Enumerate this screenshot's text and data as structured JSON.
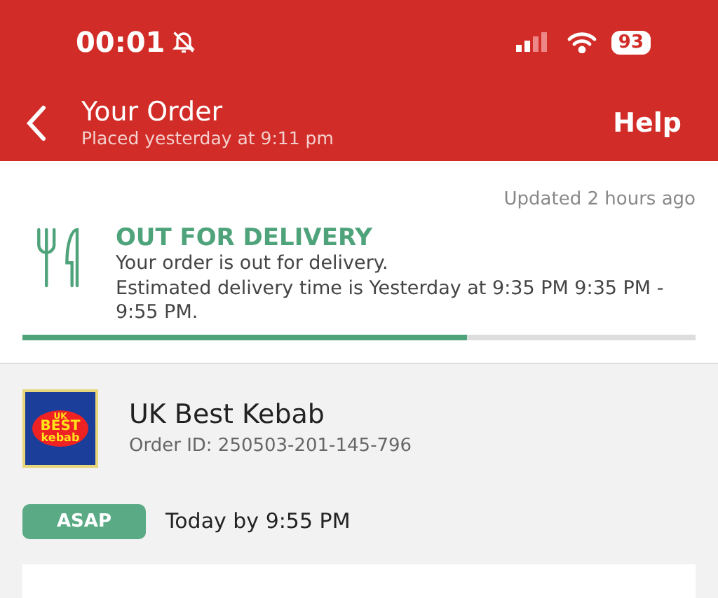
{
  "status_bar": {
    "time": "00:01",
    "silent": true,
    "battery": "93"
  },
  "header": {
    "title": "Your Order",
    "subtitle": "Placed yesterday at 9:11 pm",
    "help": "Help"
  },
  "update": {
    "text": "Updated 2 hours ago"
  },
  "delivery": {
    "status": "OUT FOR DELIVERY",
    "message": "Your order is out for delivery.",
    "estimate": "Estimated delivery time is Yesterday at 9:35 PM 9:35 PM - 9:55 PM.",
    "level": 0.66
  },
  "restaurant": {
    "name": "UK Best Kebab",
    "order_id": "Order ID: 250503-201-145-796",
    "logo": [
      "UK",
      "BEST",
      "kebab"
    ]
  },
  "timing": {
    "badge": "ASAP",
    "text": "Today by 9:55 PM"
  }
}
